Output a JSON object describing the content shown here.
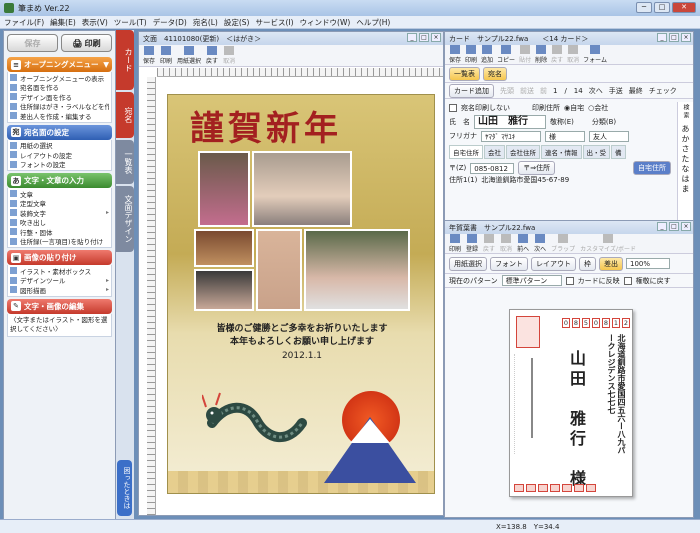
{
  "window": {
    "title": "筆まめ Ver.22",
    "min": "─",
    "max": "□",
    "close": "✕"
  },
  "menu": [
    "ファイル(F)",
    "編集(E)",
    "表示(V)",
    "ツール(T)",
    "データ(D)",
    "宛名(L)",
    "設定(S)",
    "サービス(I)",
    "ウィンドウ(W)",
    "ヘルプ(H)"
  ],
  "left": {
    "save_label": "保存",
    "print_label": "印刷",
    "sections": [
      {
        "title": "オープニングメニュー",
        "items": [
          "オープニングメニューの表示",
          "宛名面を作る",
          "デザイン面を作る",
          "住所録はがき・ラベルなどを作る",
          "差出人を作成・編集する"
        ]
      },
      {
        "title": "宛名面の設定",
        "items": [
          "用紙の選択",
          "レイアウトの設定",
          "フォントの設定"
        ]
      },
      {
        "title": "文字・文章の入力",
        "items": [
          "文章",
          "定型文章",
          "装飾文字",
          "吹き出し",
          "行整・固体",
          "住所録(一言項目)を貼り付け"
        ]
      },
      {
        "title": "画像の貼り付け",
        "items": [
          "イラスト・素材ボックス",
          "デザインツール",
          "図形描画"
        ]
      },
      {
        "title": "文字・画像の編集",
        "note": "〈文字またはイラスト・図形を選択してください〉"
      }
    ]
  },
  "vtabs": [
    "カード",
    "宛名",
    "一覧表",
    "文面デザイン"
  ],
  "help_tab": "困ったときは",
  "doc": {
    "title": "文面　41101080(更新)　＜はがき＞",
    "toolbar": [
      "保存",
      "印刷",
      "用紙選択",
      "戻す",
      "取消"
    ],
    "card_title": "謹賀新年",
    "card_msg1": "皆様のご健勝とご多幸をお祈りいたします",
    "card_msg2": "本年もよろしくお願い申し上げます",
    "card_date": "2012.1.1"
  },
  "card": {
    "title": "カード　サンプル22.fwa　　＜14 カード＞",
    "toolbar": [
      "保存",
      "印刷",
      "追加",
      "コピー",
      "貼付",
      "削除",
      "戻す",
      "取消",
      "フォーム"
    ],
    "btn_list": "一覧表",
    "btn_addr": "宛名",
    "btn_add_card": "カード追加",
    "nav": [
      "先頭",
      "前送",
      "前",
      "次へ",
      "手送",
      "最終",
      "チェック"
    ],
    "page": "1　/　14",
    "no_print": "宛名印刷しない",
    "print_addr_label": "印刷住所",
    "radio_home": "自宅",
    "radio_company": "会社",
    "name_label": "氏　名",
    "name_value": "山田　雅行",
    "furigana_label": "フリガナ",
    "furigana_value": "ﾔﾏﾀﾞ ﾏｻﾕｷ",
    "honorific_label": "敬称(E)",
    "honorific_value": "様",
    "category_label": "分類(B)",
    "category_value": "友人",
    "tabs": [
      "自宅住所",
      "会社",
      "会社住所",
      "連名・情報",
      "出・受",
      "備"
    ],
    "zip_label": "〒(Z)",
    "zip_value": "085-0812",
    "zip_btn": "〒⇒住所",
    "addr_btn": "自宅住所",
    "addr_label": "住所1(1)",
    "addr_value": "北海道釧路市愛国45-67-89",
    "kana": "あかさたなはま",
    "search": "検索"
  },
  "nenga": {
    "title": "年賀葉書　サンプル22.fwa",
    "toolbar": [
      "印刷",
      "登録",
      "戻す",
      "取消",
      "前へ",
      "次へ",
      "ブラップ",
      "カスタマイズ/ボード"
    ],
    "btn_paper": "用紙選択",
    "btn_font": "フォント",
    "btn_layout": "レイアウト",
    "btn_frame": "枠",
    "btn_sender": "差出",
    "zoom": "100%",
    "pattern_label": "現在のパターン",
    "pattern_value": "標準パターン",
    "card_reflect": "カードに反映",
    "cross_ref": "権敬に戻す",
    "pc_zip": [
      "0",
      "8",
      "5",
      "0",
      "8",
      "1",
      "2"
    ],
    "pc_addr": "北海道釧路市愛国四五六ー八九パークレジデンス七七七",
    "pc_name": "山田　雅行　様"
  },
  "status": {
    "coords": "X=138.8　Y=34.4"
  }
}
